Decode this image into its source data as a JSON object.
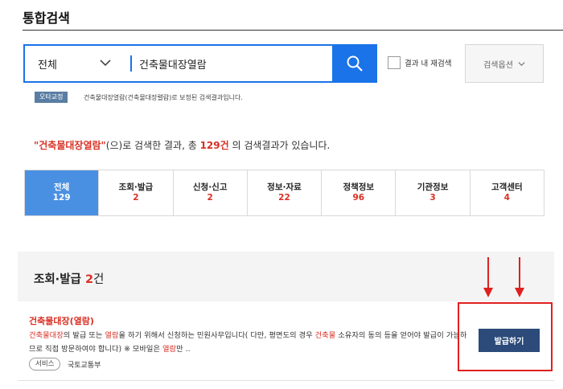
{
  "page": {
    "title": "통합검색"
  },
  "search": {
    "scope": "전체",
    "query": "건축물대장열람",
    "within_label": "결과 내 재검색",
    "options_label": "검색옵션"
  },
  "typo": {
    "badge": "오타교정",
    "message": "건축물대장열람(건축물대장렬람)로 보정된 검색결과입니다."
  },
  "summary": {
    "keyword": "\"건축물대장열람\"",
    "part1": "(으)로 검색한 결과, 총 ",
    "count": "129건",
    "part2": " 의 검색결과가 있습니다."
  },
  "tabs": [
    {
      "label": "전체",
      "count": "129"
    },
    {
      "label": "조회·발급",
      "count": "2"
    },
    {
      "label": "신청·신고",
      "count": "2"
    },
    {
      "label": "정보·자료",
      "count": "22"
    },
    {
      "label": "정책정보",
      "count": "96"
    },
    {
      "label": "기관정보",
      "count": "3"
    },
    {
      "label": "고객센터",
      "count": "4"
    }
  ],
  "section": {
    "title": "조회·발급",
    "count": "2",
    "unit": "건"
  },
  "result": {
    "title_a": "건축물대장(",
    "title_b": "열람",
    "title_c": ")",
    "d1": "건축물대장",
    "d2": "의 발급 또는 ",
    "d3": "열람",
    "d4": "을 하기 위해서 신청하는 민원사무입니다( 다만, 평면도의 경우 ",
    "d5": "건축물",
    "d6": " 소유자의 동의 등을 얻어야 발급이 가능하므로 직접 방문하여야 합니다) ※ 모바일은 ",
    "d7": "열람",
    "d8": "만 ..",
    "tag": "서비스",
    "ministry": "국토교통부",
    "button": "발급하기"
  },
  "colors": {
    "accent": "#1a73e8",
    "highlight": "#d93025",
    "annotation": "#e02020",
    "button": "#2c4a7a"
  }
}
